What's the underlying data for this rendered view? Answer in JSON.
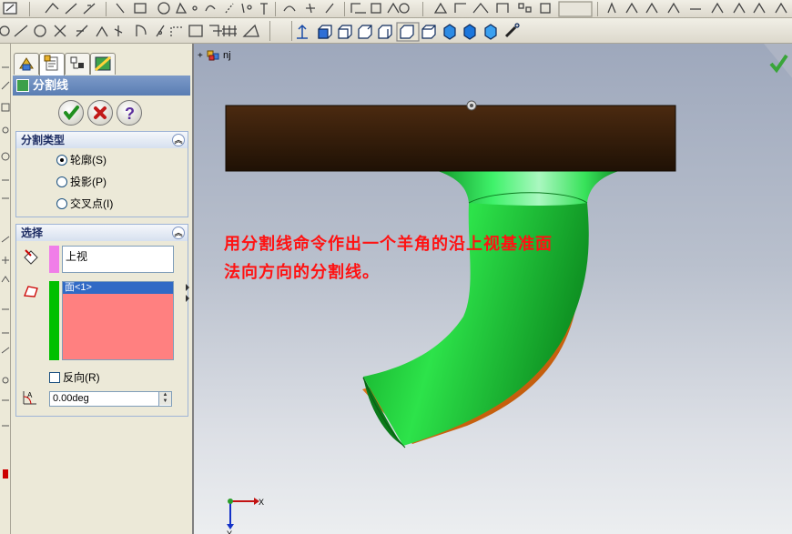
{
  "toolbar1": {
    "icons": [
      "sketch-icon",
      "smart-dimension-icon",
      "line-icon",
      "rectangle-icon",
      "circle-icon",
      "arc-icon",
      "spline-icon",
      "point-icon",
      "mirror-icon",
      "trim-icon",
      "offset-icon",
      "convert-icon",
      "linear-pattern-icon",
      "rebuild-icon",
      "extrude-icon",
      "revolve-icon",
      "sweep-icon",
      "loft-icon",
      "fillet-icon"
    ]
  },
  "toolbar2": {
    "icons": [
      "trim-entities-icon",
      "extend-icon",
      "mirror-entities-icon",
      "move-icon",
      "copy-icon",
      "rotate-icon",
      "construction-icon",
      "grid-icon",
      "dimension-icon"
    ],
    "view_icons": [
      "normal-to-icon",
      "front-view-icon",
      "back-view-icon",
      "left-view-icon",
      "right-view-icon",
      "top-view-icon",
      "isometric-view-icon",
      "shaded-icon",
      "wireframe-icon",
      "hidden-lines-icon",
      "section-view-icon"
    ]
  },
  "panel": {
    "tabs": [
      "feature-manager-tab",
      "property-manager-tab",
      "configuration-manager-tab",
      "display-manager-tab"
    ],
    "title": "分割线",
    "ok_label": "✓",
    "cancel_label": "✕",
    "help_label": "?",
    "split_type": {
      "header": "分割类型",
      "options": [
        {
          "label": "轮廓(S)",
          "selected": true
        },
        {
          "label": "投影(P)",
          "selected": false
        },
        {
          "label": "交叉点(I)",
          "selected": false
        }
      ]
    },
    "selection": {
      "header": "选择",
      "direction_value": "上视",
      "faces": [
        "面<1>"
      ],
      "reverse_label": "反向(R)",
      "reverse_checked": false,
      "angle_value": "0.00deg"
    },
    "colors": {
      "direction": "#f07ee8",
      "faces": "#00c000",
      "face_list": "#ff8080"
    }
  },
  "viewport": {
    "tree_label": "nj",
    "annotation_line1": "用分割线命令作出一个羊角的沿上视基准面",
    "annotation_line2": "法向方向的分割线。",
    "axis_x": "X",
    "axis_y": "Y",
    "colors": {
      "plate": "#3a210b",
      "green": "#22d63a",
      "orange": "#d8690d",
      "annotation": "#ff1212"
    }
  }
}
